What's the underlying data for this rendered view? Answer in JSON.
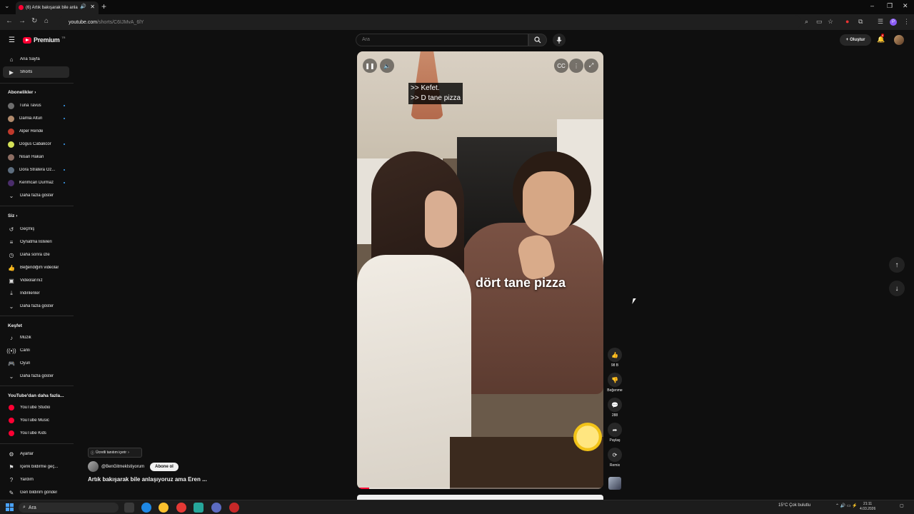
{
  "browser": {
    "tab_title": "(6) Artık bakışarak bile anla",
    "url_host": "youtube.com",
    "url_path": "/shorts/C6IJMvA_6lY"
  },
  "header": {
    "logo_text": "Premium",
    "logo_sup": "TR",
    "search_placeholder": "Ara",
    "create_label": "Oluştur",
    "notification_count": "6"
  },
  "sidebar": {
    "main": [
      {
        "label": "Ana Sayfa",
        "icon": "home-icon"
      },
      {
        "label": "Shorts",
        "icon": "shorts-icon"
      }
    ],
    "subs_heading": "Abonelikler",
    "subs": [
      {
        "label": "Tuna Tavus",
        "color": "#6d6d6d",
        "live": true
      },
      {
        "label": "Damla Altun",
        "color": "#b08a6c",
        "live": true
      },
      {
        "label": "Alper Rende",
        "color": "#c0392b",
        "live": false
      },
      {
        "label": "Dogus Cabakcor",
        "color": "#d4e157",
        "live": true
      },
      {
        "label": "Nisan Hakan",
        "color": "#8d6e63",
        "live": false
      },
      {
        "label": "Dora Stratera Öz...",
        "color": "#5d6d7e",
        "live": true
      },
      {
        "label": "Kerimcan Durmaz",
        "color": "#4a2d6b",
        "live": true
      }
    ],
    "subs_more": "Daha fazla göster",
    "you_heading": "Siz",
    "you": [
      {
        "label": "Geçmiş",
        "icon": "history-icon"
      },
      {
        "label": "Oynatma listeleri",
        "icon": "playlist-icon"
      },
      {
        "label": "Daha sonra izle",
        "icon": "clock-icon"
      },
      {
        "label": "Beğendiğim videolar",
        "icon": "like-icon"
      },
      {
        "label": "Videolarınız",
        "icon": "video-icon"
      },
      {
        "label": "İndirilenler",
        "icon": "download-icon"
      }
    ],
    "you_more": "Daha fazla göster",
    "explore_heading": "Keşfet",
    "explore": [
      {
        "label": "Müzik",
        "icon": "music-icon"
      },
      {
        "label": "Canlı",
        "icon": "live-icon"
      },
      {
        "label": "Oyun",
        "icon": "gaming-icon"
      }
    ],
    "explore_more": "Daha fazla göster",
    "more_heading": "YouTube'dan daha fazla...",
    "more": [
      {
        "label": "YouTube Studio"
      },
      {
        "label": "YouTube Music"
      },
      {
        "label": "YouTube Kids"
      }
    ],
    "settings": [
      {
        "label": "Ayarlar",
        "icon": "gear-icon"
      },
      {
        "label": "İçerik bildirme geç...",
        "icon": "flag-icon"
      },
      {
        "label": "Yardım",
        "icon": "help-icon"
      },
      {
        "label": "Geri bildirim gönder",
        "icon": "feedback-icon"
      }
    ]
  },
  "video": {
    "caption_line1": ">> Kefet.",
    "caption_line2": ">> D tane pizza",
    "big_subtitle": "dört tane pizza",
    "progress": 0.05,
    "chip_label": "Ücretli tanıtım içerir",
    "channel": "@BenGitmekIstiyorum",
    "subscribe_label": "Abone ol",
    "title": "Artık bakışarak bile anlaşıyoruz ama Eren ..."
  },
  "actions": {
    "like_count": "98 B",
    "dislike_label": "Beğenme",
    "comment_count": "288",
    "share_label": "Paylaş",
    "remix_label": "Remix"
  },
  "taskbar": {
    "search_label": "Ara",
    "weather": "15°C  Çok bulutlu",
    "time": "21:11",
    "date": "4.03.2026"
  }
}
